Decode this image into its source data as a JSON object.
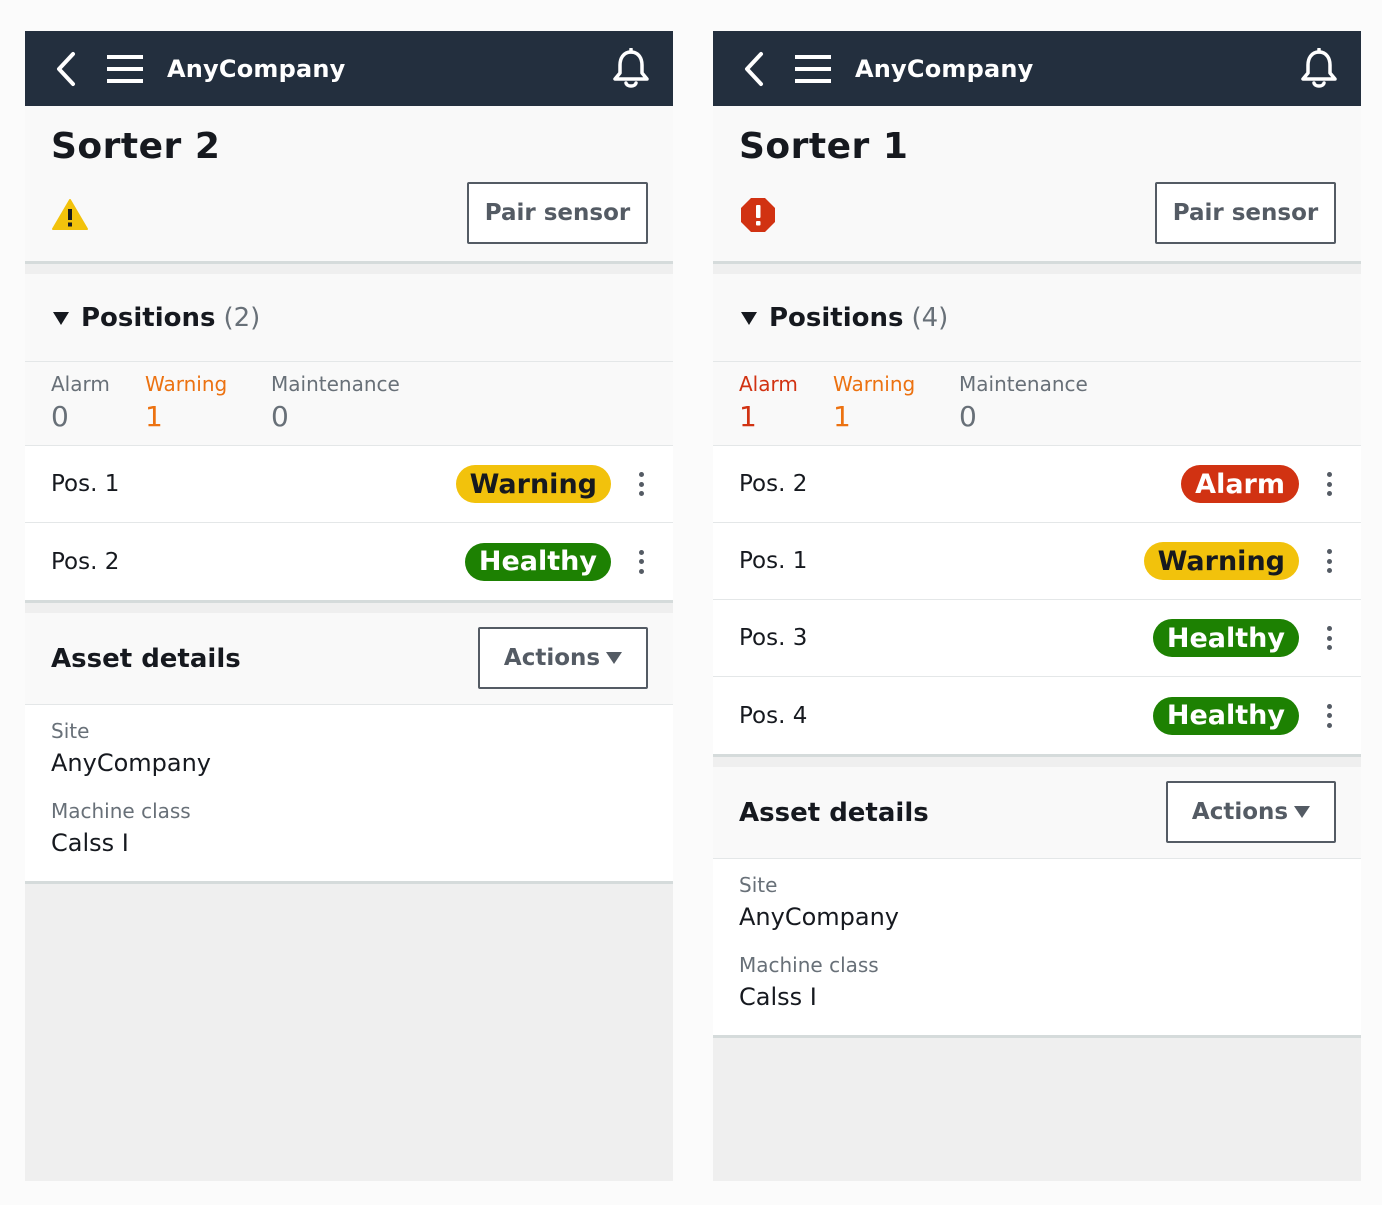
{
  "screens": [
    {
      "topbar": {
        "brand": "AnyCompany"
      },
      "title": "Sorter 2",
      "status": "warning",
      "pair_sensor_label": "Pair sensor",
      "positions": {
        "title": "Positions",
        "count": "(2)",
        "counters": {
          "alarm_label": "Alarm",
          "alarm_value": "0",
          "warning_label": "Warning",
          "warning_value": "1",
          "maintenance_label": "Maintenance",
          "maintenance_value": "0"
        },
        "rows": [
          {
            "name": "Pos. 1",
            "status": "Warning"
          },
          {
            "name": "Pos. 2",
            "status": "Healthy"
          }
        ]
      },
      "asset": {
        "title": "Asset details",
        "actions_label": "Actions",
        "site_label": "Site",
        "site_value": "AnyCompany",
        "class_label": "Machine class",
        "class_value": "Calss I"
      }
    },
    {
      "topbar": {
        "brand": "AnyCompany"
      },
      "title": "Sorter 1",
      "status": "alarm",
      "pair_sensor_label": "Pair sensor",
      "positions": {
        "title": "Positions",
        "count": "(4)",
        "counters": {
          "alarm_label": "Alarm",
          "alarm_value": "1",
          "warning_label": "Warning",
          "warning_value": "1",
          "maintenance_label": "Maintenance",
          "maintenance_value": "0"
        },
        "rows": [
          {
            "name": "Pos. 2",
            "status": "Alarm"
          },
          {
            "name": "Pos. 1",
            "status": "Warning"
          },
          {
            "name": "Pos. 3",
            "status": "Healthy"
          },
          {
            "name": "Pos. 4",
            "status": "Healthy"
          }
        ]
      },
      "asset": {
        "title": "Asset details",
        "actions_label": "Actions",
        "site_label": "Site",
        "site_value": "AnyCompany",
        "class_label": "Machine class",
        "class_value": "Calss I"
      }
    }
  ],
  "icons": {
    "back": "chevron-left-icon",
    "menu": "hamburger-menu-icon",
    "bell": "bell-icon",
    "warning_status": "warning-triangle-icon",
    "alarm_status": "alarm-octagon-icon",
    "row_menu": "kebab-menu-icon"
  },
  "colors": {
    "topbar": "#232f3e",
    "warning": "#f2c20c",
    "warning_text": "#ec7211",
    "healthy": "#1d8102",
    "alarm": "#d13212"
  }
}
